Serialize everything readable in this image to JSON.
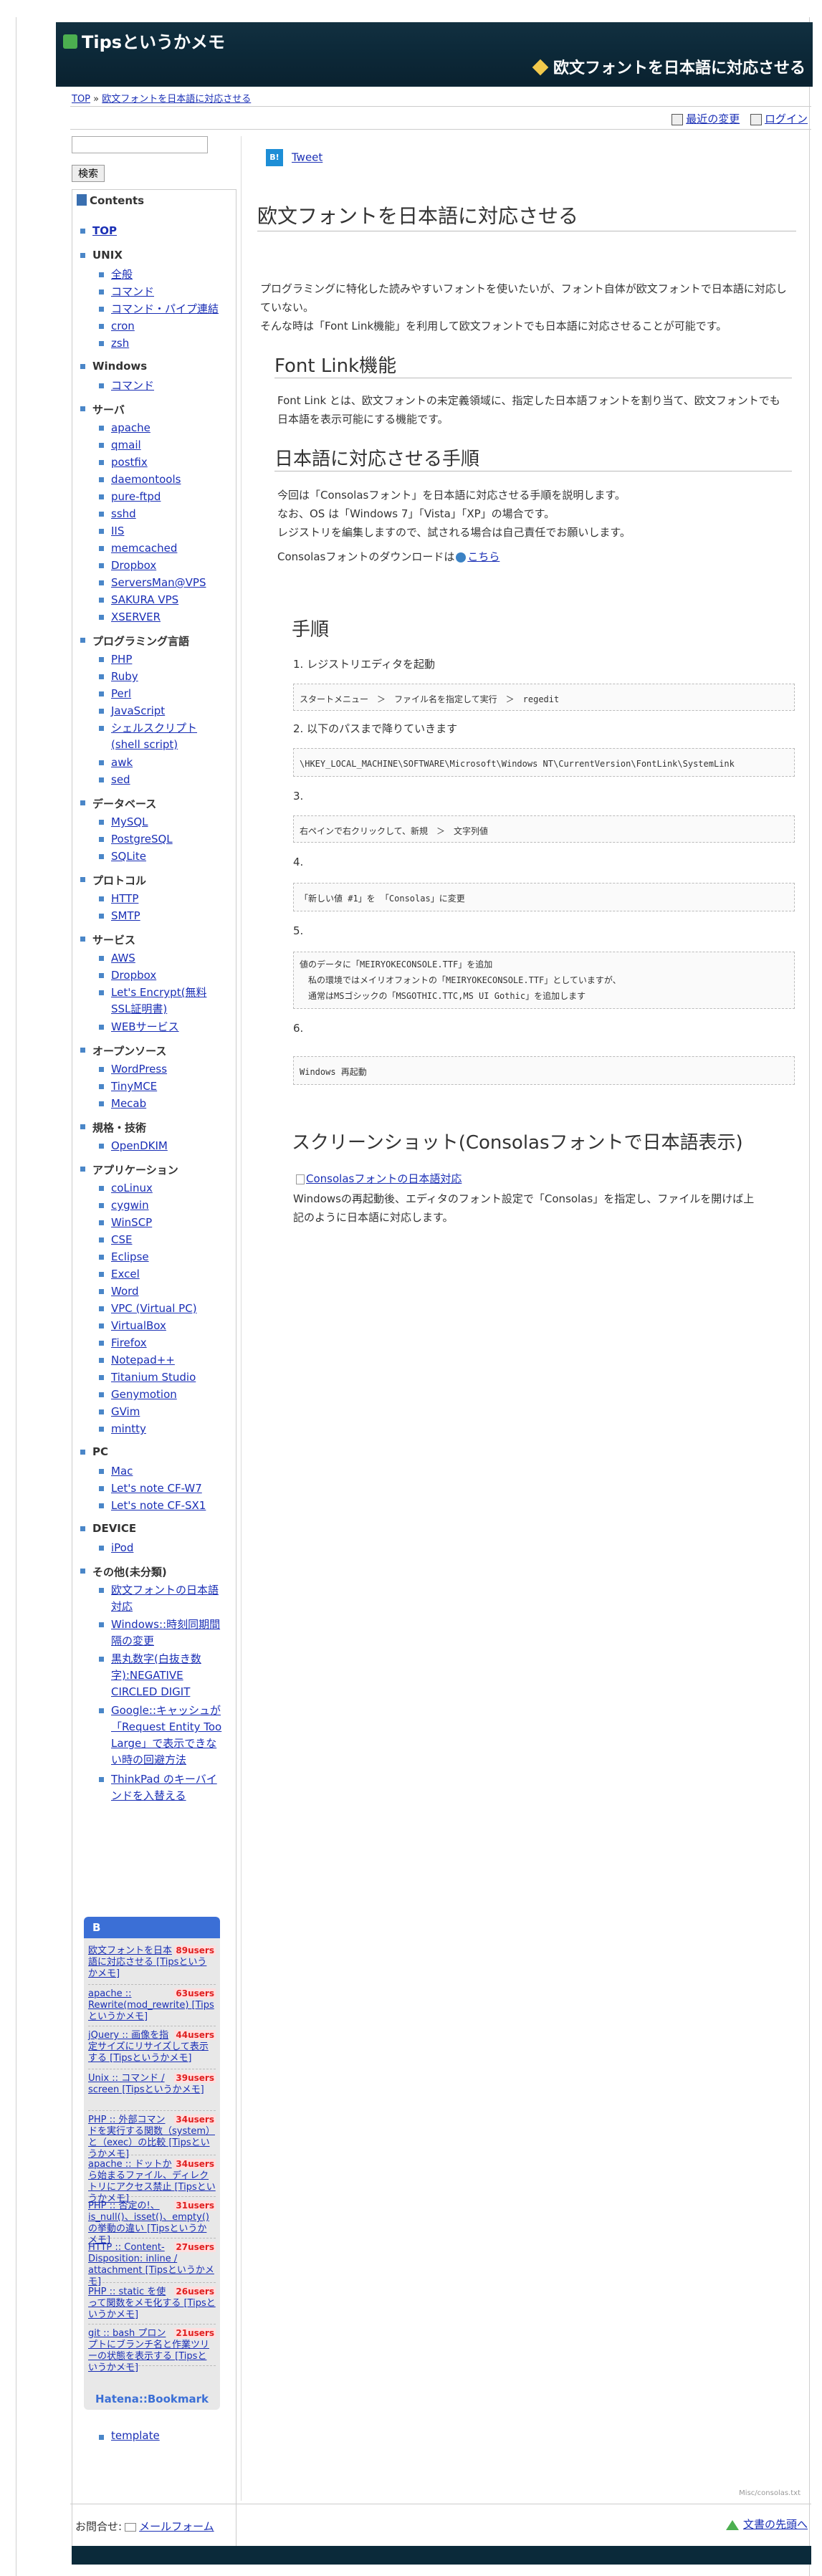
{
  "header": {
    "site_title": "Tipsというかメモ",
    "page_title": "欧文フォントを日本語に対応させる"
  },
  "breadcrumb": {
    "top": "TOP",
    "sep": " » ",
    "current": "欧文フォントを日本語に対応させる"
  },
  "toolbar": {
    "recent": "最近の変更",
    "login": "ログイン"
  },
  "search": {
    "button": "検索",
    "placeholder": ""
  },
  "menu": {
    "heading": "Contents",
    "top": "TOP",
    "sections": [
      {
        "title": "UNIX",
        "items": [
          "全般",
          "コマンド",
          "コマンド・パイプ連結",
          "cron",
          "zsh"
        ]
      },
      {
        "title": "Windows",
        "items": [
          "コマンド"
        ]
      },
      {
        "title": "サーバ",
        "items": [
          "apache",
          "qmail",
          "postfix",
          "daemontools",
          "pure-ftpd",
          "sshd",
          "IIS",
          "memcached",
          "Dropbox",
          "ServersMan@VPS",
          "SAKURA VPS",
          "XSERVER"
        ]
      },
      {
        "title": "プログラミング言語",
        "items": [
          "PHP",
          "Ruby",
          "Perl",
          "JavaScript",
          "シェルスクリプト (shell script)",
          "awk",
          "sed"
        ]
      },
      {
        "title": "データベース",
        "items": [
          "MySQL",
          "PostgreSQL",
          "SQLite"
        ]
      },
      {
        "title": "プロトコル",
        "items": [
          "HTTP",
          "SMTP"
        ]
      },
      {
        "title": "サービス",
        "items": [
          "AWS",
          "Dropbox",
          "Let's Encrypt(無料SSL証明書)",
          "WEBサービス"
        ]
      },
      {
        "title": "オープンソース",
        "items": [
          "WordPress",
          "TinyMCE",
          "Mecab"
        ]
      },
      {
        "title": "規格・技術",
        "items": [
          "OpenDKIM"
        ]
      },
      {
        "title": "アプリケーション",
        "items": [
          "coLinux",
          "cygwin",
          "WinSCP",
          "CSE",
          "Eclipse",
          "Excel",
          "Word",
          "VPC (Virtual PC)",
          "VirtualBox",
          "Firefox",
          "Notepad++",
          "Titanium Studio",
          "Genymotion",
          "GVim",
          "mintty"
        ]
      },
      {
        "title": "PC",
        "items": [
          "Mac",
          "Let's note CF-W7",
          "Let's note CF-SX1"
        ]
      },
      {
        "title": "DEVICE",
        "items": [
          "iPod"
        ]
      },
      {
        "title": "その他(未分類)",
        "items": [
          "欧文フォントの日本語対応",
          "Windows::時刻同期間隔の変更",
          "黒丸数字(白抜き数字):NEGATIVE CIRCLED DIGIT",
          "Google::キャッシュが「Request Entity Too Large」で表示できない時の回避方法",
          "ThinkPad のキーバインドを入替える"
        ]
      }
    ],
    "template": "template",
    "contact_label": "お問合せ:",
    "contact_link": "メールフォーム"
  },
  "hatena": {
    "badge": "B",
    "entries": [
      {
        "title": "欧文フォントを日本語に対応させる [Tipsというかメモ]",
        "users": "89users"
      },
      {
        "title": "apache :: Rewrite(mod_rewrite) [Tipsというかメモ]",
        "users": "63users"
      },
      {
        "title": "jQuery :: 画像を指定サイズにリサイズして表示する [Tipsというかメモ]",
        "users": "44users"
      },
      {
        "title": "Unix :: コマンド / screen [Tipsというかメモ]",
        "users": "39users"
      },
      {
        "title": "PHP :: 外部コマンドを実行する関数（system）と（exec）の比較 [Tipsというかメモ]",
        "users": "34users"
      },
      {
        "title": "apache :: ドットから始まるファイル、ディレクトリにアクセス禁止 [Tipsというかメモ]",
        "users": "34users"
      },
      {
        "title": "PHP :: 否定の!、is_null()、isset()、empty() の挙動の違い [Tipsというかメモ]",
        "users": "31users"
      },
      {
        "title": "HTTP :: Content-Disposition: inline / attachment [Tipsというかメモ]",
        "users": "27users"
      },
      {
        "title": "PHP :: static を使って関数をメモ化する [Tipsというかメモ]",
        "users": "26users"
      },
      {
        "title": "git :: bash プロンプトにブランチ名と作業ツリーの状態を表示する [Tipsというかメモ]",
        "users": "21users"
      }
    ],
    "footer": "Hatena::Bookmark"
  },
  "main": {
    "tweet": "Tweet",
    "tweet_badge": "B!",
    "title": "欧文フォントを日本語に対応させる",
    "intro1": "プログラミングに特化した読みやすいフォントを使いたいが、フォント自体が欧文フォントで日本語に対応していない。",
    "intro2": "そんな時は「Font Link機能」を利用して欧文フォントでも日本語に対応させることが可能です。",
    "h_fontlink": "Font Link機能",
    "fontlink_text": "Font Link とは、欧文フォントの未定義領域に、指定した日本語フォントを割り当て、欧文フォントでも日本語を表示可能にする機能です。",
    "h_howto": "日本語に対応させる手順",
    "howto1": "今回は「Consolasフォント」を日本語に対応させる手順を説明します。",
    "howto2": "なお、OS は「Windows 7」「Vista」「XP」の場合です。",
    "howto3": "レジストリを編集しますので、試される場合は自己責任でお願いします。",
    "download_label": "Consolasフォントのダウンロードは",
    "download_link": "こちら",
    "h_steps": "手順",
    "step1": "1. レジストリエディタを起動",
    "code1": "スタートメニュー　＞　ファイル名を指定して実行　＞　regedit",
    "step2": "2. 以下のパスまで降りていきます",
    "code2": "\\HKEY_LOCAL_MACHINE\\SOFTWARE\\Microsoft\\Windows NT\\CurrentVersion\\FontLink\\SystemLink",
    "step3": "3.",
    "code3": "右ペインで右クリックして、新規　＞　文字列値",
    "step4": "4.",
    "code4": "「新しい値 #1」を 「Consolas」に変更",
    "step5": "5.",
    "code5a": "値のデータに「MEIRYOKECONSOLE.TTF」を追加",
    "code5b": "　私の環境ではメイリオフォントの「MEIRYOKECONSOLE.TTF」としていますが、",
    "code5c": "　通常はMSゴシックの「MSGOTHIC.TTC,MS UI Gothic」を追加します",
    "step6": "6.",
    "code6": "Windows 再起動",
    "h_screenshot": "スクリーンショット(Consolasフォントで日本語表示)",
    "image_alt": "Consolasフォントの日本語対応",
    "screenshot_text1": "Windowsの再起動後、エディタのフォント設定で「Consolas」を指定し、ファイルを開けば上",
    "screenshot_text2": "記のように日本語に対応します。"
  },
  "footer": {
    "small": "Misc/consolas.txt",
    "gotop": "文書の先頭へ"
  }
}
